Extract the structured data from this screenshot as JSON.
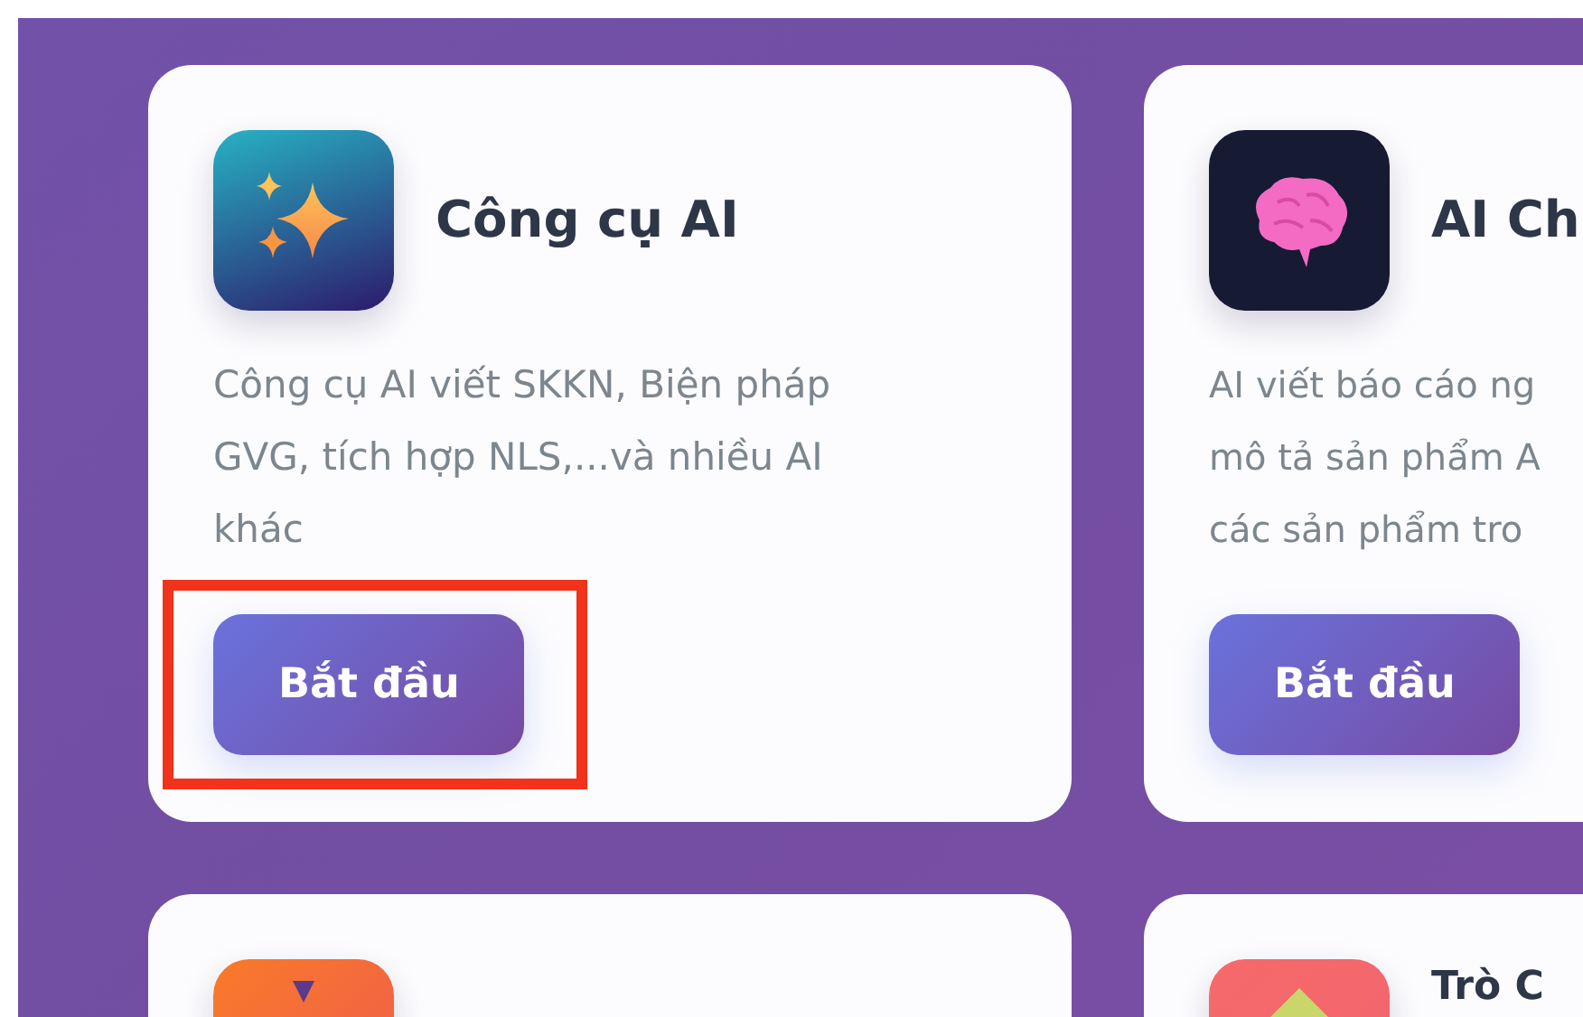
{
  "cards": [
    {
      "kind": "sparkles",
      "title": "Công cụ AI",
      "description": [
        "Công cụ AI viết SKKN, Biện pháp",
        "GVG, tích hợp NLS,...và nhiều AI",
        "khác"
      ],
      "button": "Bắt đầu",
      "highlighted": true
    },
    {
      "kind": "brain",
      "title": "AI Ch",
      "description": [
        "AI viết báo cáo ng",
        "mô tả sản phẩm A",
        "các sản phẩm tro"
      ],
      "button": "Bắt đầu",
      "highlighted": false
    },
    {
      "kind": "orange"
    },
    {
      "kind": "coral",
      "title": "Trò C"
    }
  ]
}
